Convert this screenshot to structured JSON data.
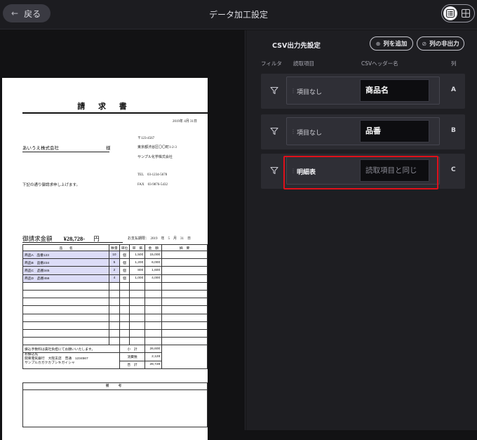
{
  "topbar": {
    "back_label": "戻る",
    "title": "データ加工設定"
  },
  "document": {
    "title": "請 求 書",
    "date": "2019年 4月 31日",
    "postal": "〒123-4567",
    "address": "東京都渋谷区〇〇町1-2-3",
    "sender": "サンプル化学株式会社",
    "tel": "TEL　03-1234-5678",
    "fax": "FAX　03-9876-5432",
    "customer": "あいうえ株式会社",
    "honorific": "様",
    "message": "下記の通り御請求申し上げます。",
    "amount_label": "御請求金額",
    "amount_value": "¥28,728-",
    "amount_unit": "円",
    "due_date": "お支払期限：　2019　年　5　月　31　日",
    "headers": [
      "品　　名",
      "数量",
      "単位",
      "単　価",
      "金　額",
      "摘　要"
    ],
    "rows": [
      {
        "name": "商品A　品番123",
        "qty": "10",
        "unit": "個",
        "price": "1,500",
        "amount": "15,000",
        "note": ""
      },
      {
        "name": "商品B　品番234",
        "qty": "5",
        "unit": "個",
        "price": "1,200",
        "amount": "6,000",
        "note": ""
      },
      {
        "name": "商品C　品番345",
        "qty": "2",
        "unit": "個",
        "price": "800",
        "amount": "1,600",
        "note": ""
      },
      {
        "name": "商品D　品番456",
        "qty": "4",
        "unit": "個",
        "price": "1,000",
        "amount": "4,000",
        "note": ""
      }
    ],
    "fee_note": "振込手数料は貴社負担にてお願いいたします。",
    "bank_label": "お振込先",
    "bank_info": "関東電気銀行　大阪支店　普通　1234567",
    "bank_name": "サンプルカガクカブシキガイシャ",
    "subtotal_label": "小　計",
    "subtotal_value": "26,600",
    "tax_label": "消費税",
    "tax_value": "2,128",
    "total_label": "合　計",
    "total_value": "28,728",
    "remarks_label": "備　考"
  },
  "settings": {
    "title": "CSV出力先設定",
    "add_column_label": "列を追加",
    "hide_column_label": "列の非出力",
    "col_filter": "フィルタ",
    "col_source": "読取項目",
    "col_header": "CSVヘッダー名",
    "col_letter": "列",
    "mappings": [
      {
        "source": "項目なし",
        "header": "商品名",
        "placeholder": "",
        "letter": "A"
      },
      {
        "source": "項目なし",
        "header": "品番",
        "placeholder": "",
        "letter": "B"
      },
      {
        "source": "明細表",
        "header": "",
        "placeholder": "読取項目と同じ",
        "letter": "C"
      }
    ]
  },
  "colors": {
    "background": "#121214",
    "panel": "#1e1e22",
    "row": "#2b2b31",
    "focus": "#e0101a",
    "highlight": "#dcdcf7"
  }
}
